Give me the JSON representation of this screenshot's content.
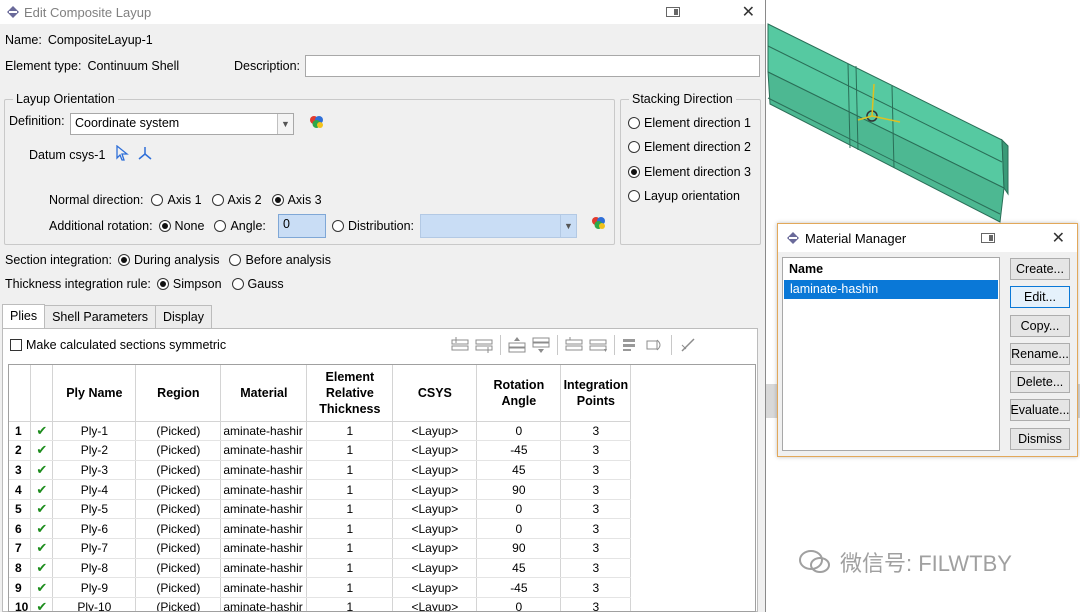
{
  "dialog": {
    "title": "Edit Composite Layup",
    "name_label": "Name:",
    "name_value": "CompositeLayup-1",
    "element_type_label": "Element type:",
    "element_type_value": "Continuum Shell",
    "description_label": "Description:",
    "description_value": ""
  },
  "layup_orientation": {
    "legend": "Layup Orientation",
    "definition_label": "Definition:",
    "definition_value": "Coordinate system",
    "datum_label": "Datum csys-1",
    "normal_label": "Normal direction:",
    "normal_options": [
      "Axis 1",
      "Axis 2",
      "Axis 3"
    ],
    "normal_selected": 2,
    "addrot_label": "Additional rotation:",
    "addrot_none": "None",
    "addrot_angle": "Angle:",
    "addrot_angle_value": "0",
    "addrot_distribution": "Distribution:",
    "addrot_selected": "None"
  },
  "stacking": {
    "legend": "Stacking Direction",
    "options": [
      "Element direction 1",
      "Element direction 2",
      "Element direction 3",
      "Layup orientation"
    ],
    "selected": 2
  },
  "section_integration": {
    "label": "Section integration:",
    "options": [
      "During analysis",
      "Before analysis"
    ],
    "selected": 0
  },
  "thickness_integration": {
    "label": "Thickness integration rule:",
    "options": [
      "Simpson",
      "Gauss"
    ],
    "selected": 0
  },
  "tabs": [
    "Plies",
    "Shell Parameters",
    "Display"
  ],
  "active_tab": 0,
  "plies": {
    "symmetric_label": "Make calculated sections symmetric",
    "columns": [
      "Ply Name",
      "Region",
      "Material",
      "Element Relative Thickness",
      "CSYS",
      "Rotation Angle",
      "Integration Points"
    ],
    "rows": [
      {
        "n": "1",
        "name": "Ply-1",
        "region": "(Picked)",
        "material": "aminate-hashir",
        "thickness": "1",
        "csys": "<Layup>",
        "angle": "0",
        "points": "3"
      },
      {
        "n": "2",
        "name": "Ply-2",
        "region": "(Picked)",
        "material": "aminate-hashir",
        "thickness": "1",
        "csys": "<Layup>",
        "angle": "-45",
        "points": "3"
      },
      {
        "n": "3",
        "name": "Ply-3",
        "region": "(Picked)",
        "material": "aminate-hashir",
        "thickness": "1",
        "csys": "<Layup>",
        "angle": "45",
        "points": "3"
      },
      {
        "n": "4",
        "name": "Ply-4",
        "region": "(Picked)",
        "material": "aminate-hashir",
        "thickness": "1",
        "csys": "<Layup>",
        "angle": "90",
        "points": "3"
      },
      {
        "n": "5",
        "name": "Ply-5",
        "region": "(Picked)",
        "material": "aminate-hashir",
        "thickness": "1",
        "csys": "<Layup>",
        "angle": "0",
        "points": "3"
      },
      {
        "n": "6",
        "name": "Ply-6",
        "region": "(Picked)",
        "material": "aminate-hashir",
        "thickness": "1",
        "csys": "<Layup>",
        "angle": "0",
        "points": "3"
      },
      {
        "n": "7",
        "name": "Ply-7",
        "region": "(Picked)",
        "material": "aminate-hashir",
        "thickness": "1",
        "csys": "<Layup>",
        "angle": "90",
        "points": "3"
      },
      {
        "n": "8",
        "name": "Ply-8",
        "region": "(Picked)",
        "material": "aminate-hashir",
        "thickness": "1",
        "csys": "<Layup>",
        "angle": "45",
        "points": "3"
      },
      {
        "n": "9",
        "name": "Ply-9",
        "region": "(Picked)",
        "material": "aminate-hashir",
        "thickness": "1",
        "csys": "<Layup>",
        "angle": "-45",
        "points": "3"
      },
      {
        "n": "10",
        "name": "Ply-10",
        "region": "(Picked)",
        "material": "aminate-hashir",
        "thickness": "1",
        "csys": "<Layup>",
        "angle": "0",
        "points": "3"
      }
    ]
  },
  "material_manager": {
    "title": "Material Manager",
    "list_header": "Name",
    "items": [
      "laminate-hashin"
    ],
    "buttons": [
      "Create...",
      "Edit...",
      "Copy...",
      "Rename...",
      "Delete...",
      "Evaluate...",
      "Dismiss"
    ]
  },
  "watermark": "微信号: FILWTBY",
  "colors": {
    "model": "#52c8a0",
    "selection": "#0a78d7",
    "check": "#1c8c1c"
  }
}
